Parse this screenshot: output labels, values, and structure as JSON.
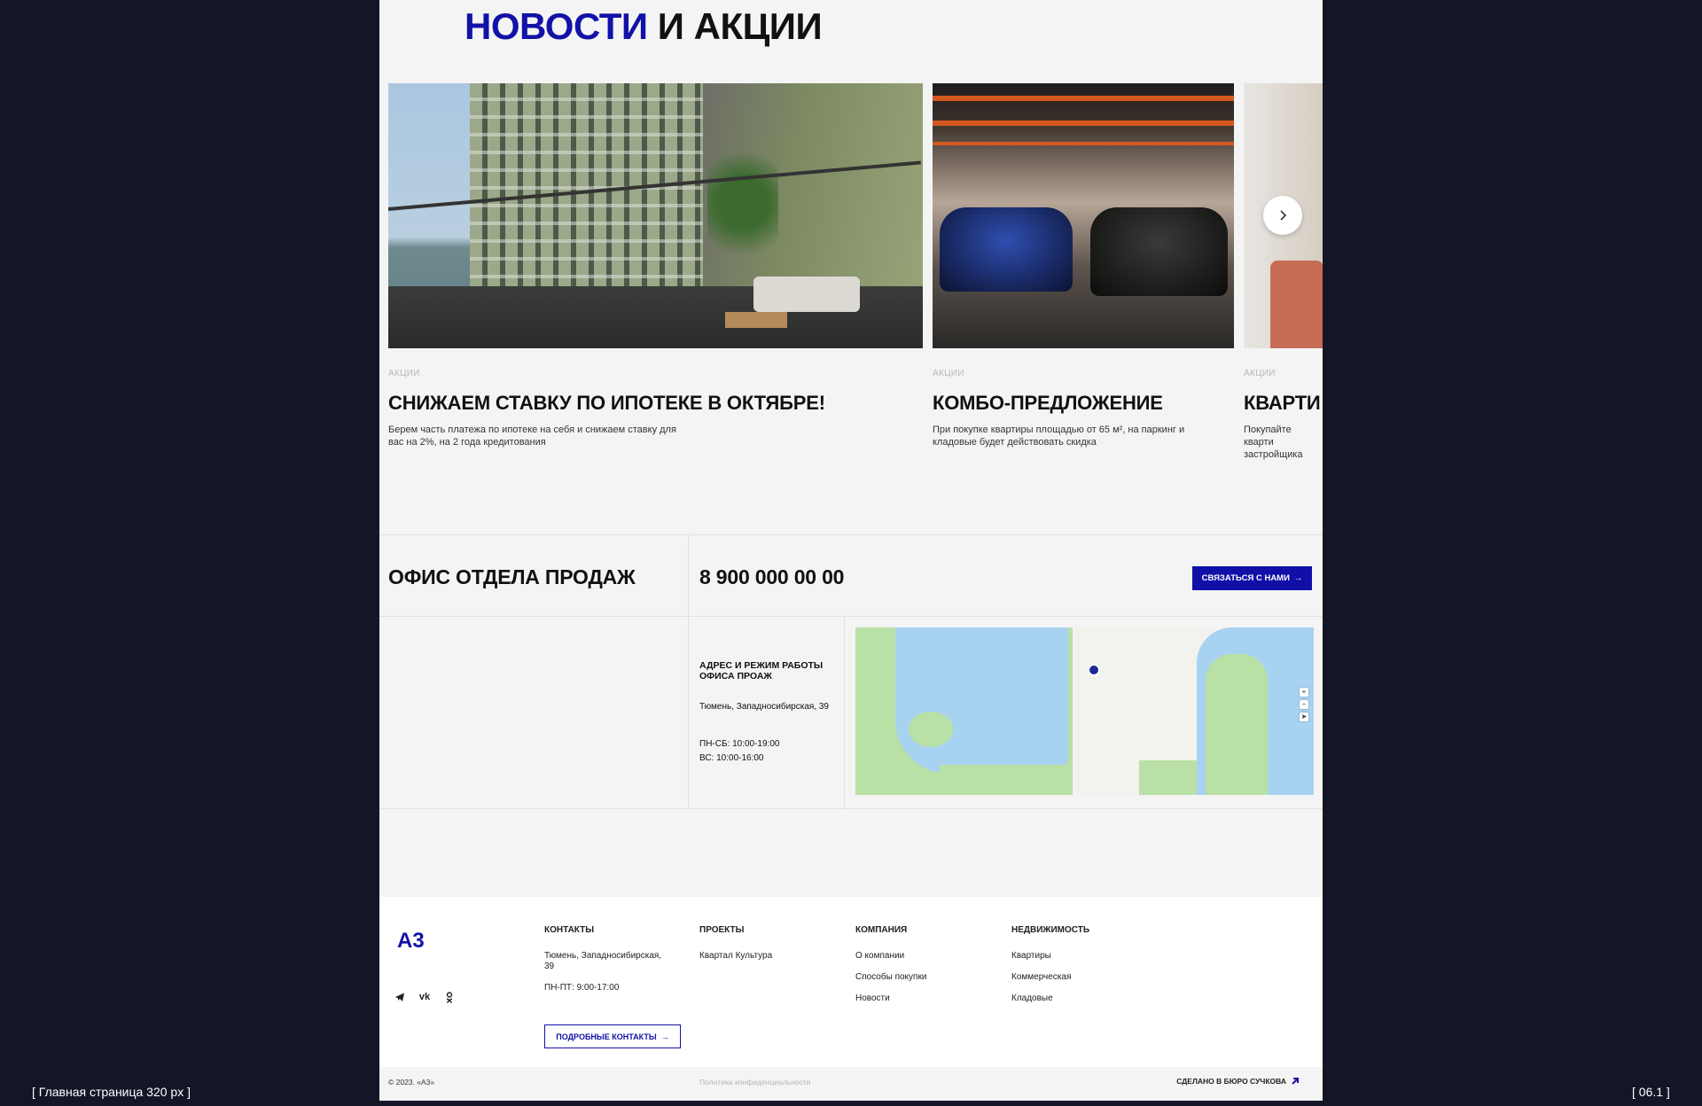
{
  "news": {
    "title_accent": "НОВОСТИ",
    "title_rest": "И АКЦИИ",
    "cards": [
      {
        "tag": "АКЦИИ",
        "title": "СНИЖАЕМ СТАВКУ ПО ИПОТЕКЕ В ОКТЯБРЕ!",
        "desc": "Берем часть платежа по ипотеке на себя и снижаем ставку для вас на 2%, на 2 года кредитования"
      },
      {
        "tag": "АКЦИИ",
        "title": "КОМБО-ПРЕДЛОЖЕНИЕ",
        "desc": "При покупке квартиры площадью от 65 м², на паркинг и кладовые будет действовать скидка"
      },
      {
        "tag": "АКЦИИ",
        "title": "КВАРТИ",
        "desc": "Покупайте кварти застройщика"
      }
    ],
    "next_icon": "chevron-right-icon"
  },
  "office": {
    "title": "ОФИС ОТДЕЛА ПРОДАЖ",
    "phone": "8 900 000 00 00",
    "contact_button": "СВЯЗАТЬСЯ С НАМИ",
    "address_heading": "АДРЕС И РЕЖИМ РАБОТЫ ОФИСА ПРОАЖ",
    "address": "Тюмень, Западносибирская, 39",
    "hours_weekdays": "ПН-СБ: 10:00-19:00",
    "hours_sunday": "ВС: 10:00-16:00"
  },
  "footer": {
    "logo": "А3",
    "contacts": {
      "heading": "КОНТАКТЫ",
      "address": "Тюмень, Западносибирская, 39",
      "hours": "ПН-ПТ: 9:00-17:00",
      "button": "ПОДРОБНЫЕ КОНТАКТЫ"
    },
    "projects": {
      "heading": "ПРОЕКТЫ",
      "items": [
        "Квартал Культура"
      ]
    },
    "company": {
      "heading": "КОМПАНИЯ",
      "items": [
        "О компании",
        "Способы покупки",
        "Новости"
      ]
    },
    "realty": {
      "heading": "НЕДВИЖИМОСТЬ",
      "items": [
        "Квартиры",
        "Коммерческая",
        "Кладовые"
      ]
    },
    "socials": [
      "telegram-icon",
      "vk-icon",
      "odnoklassniki-icon"
    ]
  },
  "bottom": {
    "copyright": "© 2023. «А3»",
    "privacy": "Политика конфиденциальности",
    "made_by": "СДЕЛАНО В БЮРО СУЧКОВА"
  },
  "captions": {
    "left": "[  Главная страница 320 px  ]",
    "right": "[  06.1  ]"
  },
  "colors": {
    "accent": "#1212a8",
    "background": "#141628",
    "page": "#f4f4f4"
  }
}
